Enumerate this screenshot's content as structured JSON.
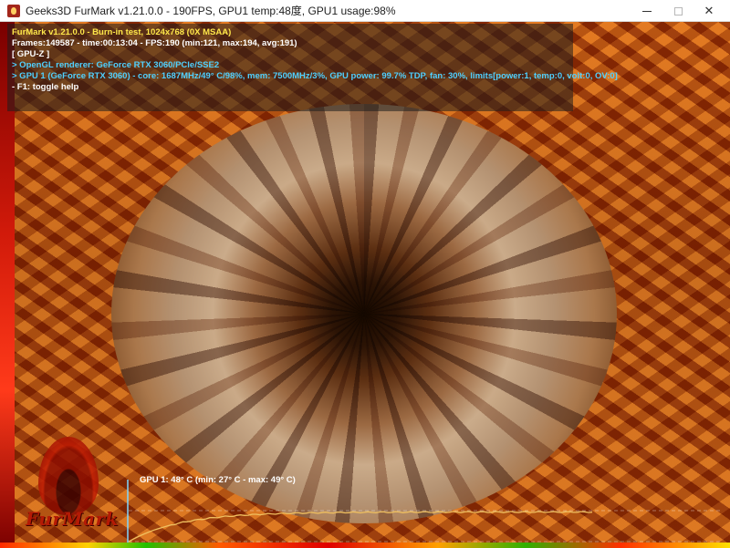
{
  "window": {
    "title": "Geeks3D FurMark v1.21.0.0 - 190FPS, GPU1 temp:48度, GPU1 usage:98%",
    "controls": {
      "minimize": "—",
      "maximize": "☐",
      "close": "✕"
    }
  },
  "info": {
    "version_line": "FurMark v1.21.0.0 - Burn-in test, 1024x768 (0X MSAA)",
    "frames_line": "Frames:149587 - time:00:13:04 - FPS:190 (min:121, max:194, avg:191)",
    "gpuz_line": "[ GPU-Z ]",
    "renderer_line": "> OpenGL renderer: GeForce RTX 3060/PCIe/SSE2",
    "gpu_line": "> GPU 1 (GeForce RTX 3060) - core: 1687MHz/49° C/98%, mem: 7500MHz/3%, GPU power: 99.7% TDP, fan: 30%, limits[power:1, temp:0, volt:0, OV:0]",
    "help_line": "- F1: toggle help"
  },
  "logo": {
    "text": "FurMark"
  },
  "temperature_graph": {
    "label": "GPU 1: 48° C (min: 27° C - max: 49° C)",
    "current_c": 48,
    "min_c": 27,
    "max_c": 49,
    "line_color": "#f0c060",
    "axis_color": "#7fd6ff"
  },
  "colors": {
    "title_bar": "#ffffff",
    "info_yellow": "#ffe84a",
    "info_cyan": "#4fd0ff"
  }
}
